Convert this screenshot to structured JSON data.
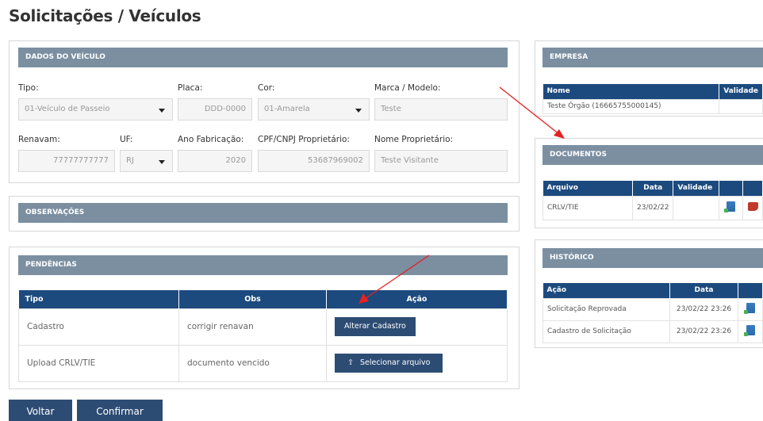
{
  "page_title": "Solicitações / Veículos",
  "dados": {
    "header": "DADOS DO VEÍCULO",
    "tipo_label": "Tipo:",
    "tipo_value": "01-Veículo de Passeio",
    "placa_label": "Placa:",
    "placa_value": "DDD-0000",
    "cor_label": "Cor:",
    "cor_value": "01-Amarela",
    "marca_label": "Marca / Modelo:",
    "marca_value": "Teste",
    "renavam_label": "Renavam:",
    "renavam_value": "77777777777",
    "uf_label": "UF:",
    "uf_value": "RJ",
    "ano_label": "Ano Fabricação:",
    "ano_value": "2020",
    "cpf_label": "CPF/CNPJ Proprietário:",
    "cpf_value": "53687969002",
    "nome_label": "Nome Proprietário:",
    "nome_value": "Teste Visitante"
  },
  "observacoes": {
    "header": "OBSERVAÇÕES"
  },
  "pendencias": {
    "header": "PENDÊNCIAS",
    "columns": [
      "Tipo",
      "Obs",
      "Ação"
    ],
    "rows": [
      {
        "tipo": "Cadastro",
        "obs": "corrigir renavan",
        "acao": "Alterar Cadastro"
      },
      {
        "tipo": "Upload CRLV/TIE",
        "obs": "documento vencido",
        "acao": "Selecionar arquivo"
      }
    ]
  },
  "empresa": {
    "header": "EMPRESA",
    "columns": [
      "Nome",
      "Validade"
    ],
    "rows": [
      {
        "nome": "Teste Órgão (16665755000145)",
        "validade": ""
      }
    ]
  },
  "documentos": {
    "header": "DOCUMENTOS",
    "columns": [
      "Arquivo",
      "Data",
      "Validade"
    ],
    "rows": [
      {
        "arquivo": "CRLV/TIE",
        "data": "23/02/22",
        "validade": ""
      }
    ]
  },
  "historico": {
    "header": "HISTÓRICO",
    "columns": [
      "Ação",
      "Data"
    ],
    "rows": [
      {
        "acao": "Solicitação Reprovada",
        "data": "23/02/22 23:26"
      },
      {
        "acao": "Cadastro de Solicitação",
        "data": "23/02/22 23:26"
      }
    ]
  },
  "footer": {
    "voltar": "Voltar",
    "confirmar": "Confirmar"
  },
  "colors": {
    "header_bg": "#7b8fa1",
    "table_head": "#1c4a7e",
    "button": "#2d4c73",
    "arrow": "#e52121"
  },
  "icons": [
    "caret-down-icon",
    "upload-icon",
    "document-icon",
    "thumbs-down-icon"
  ]
}
